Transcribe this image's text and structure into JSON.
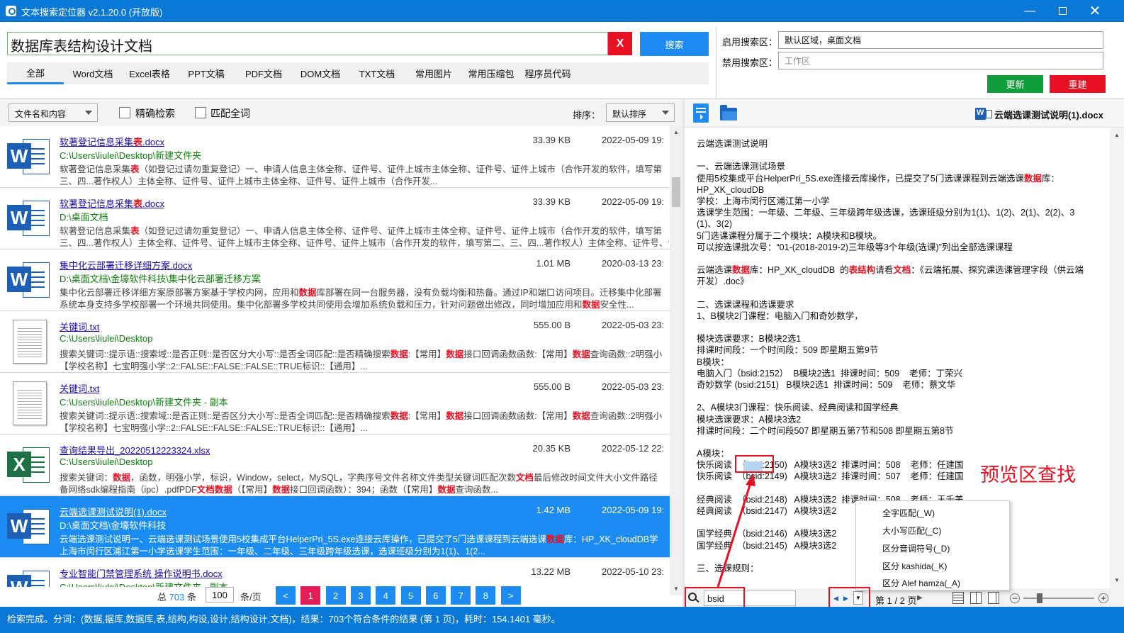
{
  "window": {
    "title": "文本搜索定位器 v2.1.20.0 (开放版)"
  },
  "search": {
    "query": "数据库表结构设计文档",
    "clear_label": "X",
    "button_label": "搜索"
  },
  "tabs": [
    "全部",
    "Word文档",
    "Excel表格",
    "PPT文稿",
    "PDF文档",
    "DOM文档",
    "TXT文档",
    "常用图片",
    "常用压缩包",
    "程序员代码"
  ],
  "areas": {
    "enabled_label": "启用搜索区：",
    "enabled_value": "默认区域，桌面文档",
    "disabled_label": "禁用搜索区：",
    "disabled_placeholder": "工作区",
    "update_label": "更新",
    "rebuild_label": "重建"
  },
  "filter": {
    "scope": "文件名和内容",
    "exact_label": "精确检索",
    "whole_label": "匹配全词",
    "sort_label": "排序：",
    "sort_value": "默认排序"
  },
  "results": [
    {
      "type": "word",
      "name": "软著登记信息采集[[表]].docx",
      "path": "C:\\Users\\liulei\\Desktop\\新建文件夹",
      "size": "33.39 KB",
      "date": "2022-05-09 19:",
      "snippet1": "软著登记信息采集[[表]]（如登记过请勿重复登记）一、申请人信息主体全称、证件号、证件上城市主体全称、证件号、证件上城市（合作开发的软件，填写第",
      "snippet2": "三、四...著作权人）主体全称、证件号、证件上城市主体全称、证件号、证件上城市（合作开发..."
    },
    {
      "type": "word",
      "name": "软著登记信息采集[[表]].docx",
      "path": "D:\\桌面文档",
      "size": "33.39 KB",
      "date": "2022-05-09 19:",
      "snippet1": "软著登记信息采集[[表]]（如登记过请勿重复登记）一、申请人信息主体全称、证件号、证件上城市主体全称、证件号、证件上城市（合作开发的软件，填写第",
      "snippet2": "三、四...著作权人）主体全称、证件号、证件上城市主体全称、证件号、证件上城市（合作开发的软件，填写第二、三、四...著作权人）主体全称、证件号、证件上城市（合作开发..."
    },
    {
      "type": "word",
      "name": "集中化云部署迁移详细方案.docx",
      "path": "D:\\桌面文档\\金壕软件科技\\集中化云部署迁移方案",
      "size": "1.01 MB",
      "date": "2020-03-13 23:",
      "snippet1": "集中化云部署迁移详细方案原部署方案基于学校内网，应用和[[数据]]库部署在同一台服务器，没有负载均衡和热备。通过IP和端口访问项目。迁移集中化部署",
      "snippet2": "系统本身支持多学校部署一个环境共同使用。集中化部署多学校共同使用会增加系统负载和压力，针对问题做出修改，同时增加应用和[[数据]]安全性..."
    },
    {
      "type": "txt",
      "name": "关键词.txt",
      "path": "C:\\Users\\liulei\\Desktop",
      "size": "555.00 B",
      "date": "2022-05-03 23:",
      "snippet1": "搜索关键词::提示语::搜索域::是否正则::是否区分大小写::是否全词匹配::是否精确搜索[[数据]]:【常用】[[数据]]接口回调函数函数:【常用】[[数据]]查询函数::2明强小",
      "snippet2": "【学校名称】七宝明强小学::2::FALSE::FALSE::FALSE::TRUE标识::【通用】..."
    },
    {
      "type": "txt",
      "name": "关键词.txt",
      "path": "C:\\Users\\liulei\\Desktop\\新建文件夹 - 副本",
      "size": "555.00 B",
      "date": "2022-05-03 23:",
      "snippet1": "搜索关键词::提示语::搜索域::是否正则::是否区分大小写::是否全词匹配::是否精确搜索[[数据]]:【常用】[[数据]]接口回调函数函数:【常用】[[数据]]查询函数::2明强小",
      "snippet2": "【学校名称】七宝明强小学::2::FALSE::FALSE::FALSE::TRUE标识::【通用】..."
    },
    {
      "type": "excel",
      "name": "查询结果导出_20220512223324.xlsx",
      "path": "C:\\Users\\liulei\\Desktop",
      "size": "20.35 KB",
      "date": "2022-05-12 22:",
      "snippet1": "搜索关键词：[[数据]]，函数，明强小学，标识，Window，select，MySQL，字典序号文件名称文件类型关键词匹配次数[[文档]]最后修改时间文件大小文件路径",
      "snippet2": "备网络sdk编程指南（ipc）.pdfPDF[[文档数据]]（【常用】[[数据]]接口回调函数）：394；函数（【常用】[[数据]]查询函数..."
    },
    {
      "type": "word",
      "selected": true,
      "name": "云端选课测试说明(1).docx",
      "path": "D:\\桌面文档\\金壕软件科技",
      "size": "1.42 MB",
      "date": "2022-05-09 19:",
      "snippet1": "云端选课测试说明一、云端选课测试场景使用5校集成平台HelperPri_5S.exe连接云库操作，已提交了5门选课课程到云端选课[[数据]]库：HP_XK_cloudDB学",
      "snippet2": "上海市闵行区浦江第一小学选课学生范围：一年级、二年级、三年级跨年级选课，选课班级分别为1(1)、1(2..."
    },
    {
      "type": "word",
      "name": "专业智能门禁管理系统 操作说明书.docx",
      "path": "C:\\Users\\liulei\\Desktop\\新建文件夹 - 副本",
      "size": "13.22 MB",
      "date": "2022-05-10 23:",
      "snippet1": "",
      "snippet2": ""
    }
  ],
  "pager": {
    "total_prefix": "总",
    "total": "703",
    "total_suffix": "条",
    "page_size": "100",
    "page_size_suffix": "条/页",
    "prev": "<",
    "next": ">",
    "pages": [
      "1",
      "2",
      "3",
      "4",
      "5",
      "6",
      "7",
      "8"
    ],
    "current": "1"
  },
  "preview": {
    "filename": "云端选课测试说明(1).docx",
    "lines": [
      "云端选课测试说明",
      "",
      "一、云端选课测试场景",
      "使用5校集成平台HelperPri_5S.exe连接云库操作，已提交了5门选课课程到云端选课[[数据]]库：",
      "HP_XK_cloudDB",
      "学校：上海市闵行区浦江第一小学",
      "选课学生范围：一年级、二年级、三年级跨年级选课，选课班级分别为1(1)、1(2)、2(1)、2(2)、3",
      "(1)、3(2)",
      "5门选课课程分属于二个模块：A模块和B模块。",
      "可以按选课批次号：“01-(2018-2019-2)三年级等3个年级(选课)”列出全部选课课程",
      "",
      "云端选课[[数据]]库：HP_XK_cloudDB  的[[表结构]]请看[[文档]]：《云端拓展、探究课选课管理字段（供云端",
      "开发）.doc》",
      "",
      "二、选课课程和选课要求",
      "1、B模块2门课程：电脑入门和奇妙数学，",
      "",
      "模块选课要求：B模块2选1",
      "排课时间段：一个时间段：509 即星期五第9节",
      "B模块：",
      "电脑入门（bsid:2152）  B模块2选1  排课时间：509    老师：丁荣兴",
      "奇妙数学 (bsid:2151)   B模块2选1  排课时间：509    老师：蔡文华",
      "",
      "2、A模块3门课程：快乐阅读、经典阅读和国学经典",
      "模块选课要求：A模块3选2",
      "排课时间段：二个时间段507 即星期五第7节和508 即星期五第8节",
      "",
      "A模块：",
      "快乐阅读  （bsid:2150)   A模块3选2  排课时间：508    老师：任建国",
      "快乐阅读  （bsid:2149)   A模块3选2  排课时间：507    老师：任建国",
      "",
      "经典阅读  （bsid:2148)   A模块3选2  排课时间：508    老师：王千美",
      "经典阅读  （bsid:2147)   A模块3选2",
      "",
      "国学经典  （bsid:2146)   A模块3选2",
      "国学经典  （bsid:2145)   A模块3选2",
      "",
      "三、选课规则："
    ],
    "find_value": "bsid",
    "page_indicator": "第 1 / 2 页",
    "annotation": "预览区查找"
  },
  "context_menu": [
    "全字匹配(_W)",
    "大小写匹配(_C)",
    "区分音调符号(_D)",
    "区分 kashida(_K)",
    "区分 Alef hamza(_A)"
  ],
  "status": "检索完成。分词：(数据,据库,数据库,表,结构,构设,设计,结构设计,文档)，结果：703个符合条件的结果 (第 1 页)，耗时：154.1401 毫秒。",
  "colors": {
    "accent": "#1d8bf1",
    "title_bar": "#0a78d7",
    "highlight": "#e81123",
    "path_green": "#107c10",
    "update_green": "#109e3c"
  }
}
